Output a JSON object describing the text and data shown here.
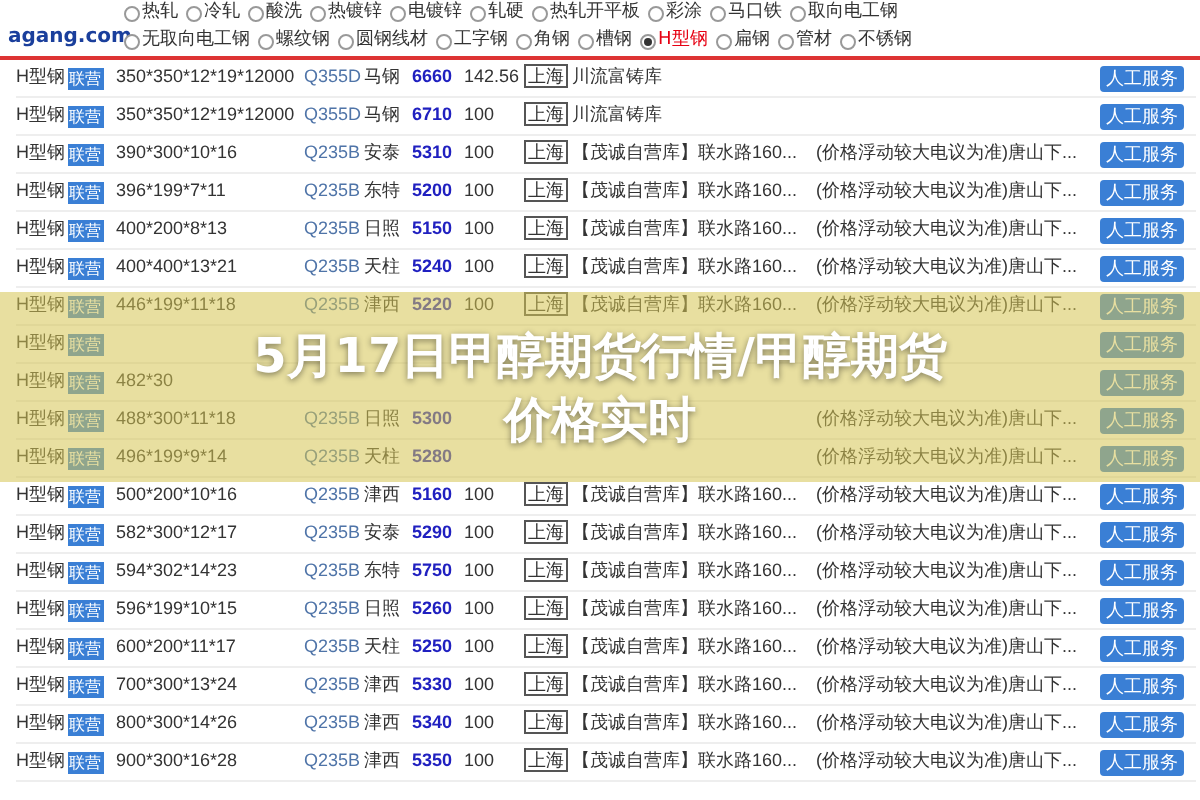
{
  "header": {
    "logo": "agang.com",
    "filters": [
      {
        "label": "热轧",
        "selected": false
      },
      {
        "label": "冷轧",
        "selected": false
      },
      {
        "label": "酸洗",
        "selected": false
      },
      {
        "label": "热镀锌",
        "selected": false
      },
      {
        "label": "电镀锌",
        "selected": false
      },
      {
        "label": "轧硬",
        "selected": false
      },
      {
        "label": "热轧开平板",
        "selected": false
      },
      {
        "label": "彩涂",
        "selected": false
      },
      {
        "label": "马口铁",
        "selected": false
      },
      {
        "label": "取向电工钢",
        "selected": false
      },
      {
        "label": "无取向电工钢",
        "selected": false
      },
      {
        "label": "螺纹钢",
        "selected": false
      },
      {
        "label": "圆钢线材",
        "selected": false
      },
      {
        "label": "工字钢",
        "selected": false
      },
      {
        "label": "角钢",
        "selected": false
      },
      {
        "label": "槽钢",
        "selected": false
      },
      {
        "label": "H型钢",
        "selected": true
      },
      {
        "label": "扁钢",
        "selected": false
      },
      {
        "label": "管材",
        "selected": false
      },
      {
        "label": "不锈钢",
        "selected": false
      }
    ]
  },
  "rows": [
    {
      "name": "H型钢",
      "badge": "联营",
      "spec": "350*350*12*19*12000",
      "material": "Q355D",
      "brand": "马钢",
      "price": "6660",
      "qty": "142.56",
      "city": "上海",
      "warehouse": "川流富铸库",
      "note": "",
      "action": "人工服务"
    },
    {
      "name": "H型钢",
      "badge": "联营",
      "spec": "350*350*12*19*12000",
      "material": "Q355D",
      "brand": "马钢",
      "price": "6710",
      "qty": "100",
      "city": "上海",
      "warehouse": "川流富铸库",
      "note": "",
      "action": "人工服务"
    },
    {
      "name": "H型钢",
      "badge": "联营",
      "spec": "390*300*10*16",
      "material": "Q235B",
      "brand": "安泰",
      "price": "5310",
      "qty": "100",
      "city": "上海",
      "warehouse": "【茂诚自营库】联水路160...",
      "note": "(价格浮动较大电议为准)唐山下...",
      "action": "人工服务"
    },
    {
      "name": "H型钢",
      "badge": "联营",
      "spec": "396*199*7*11",
      "material": "Q235B",
      "brand": "东特",
      "price": "5200",
      "qty": "100",
      "city": "上海",
      "warehouse": "【茂诚自营库】联水路160...",
      "note": "(价格浮动较大电议为准)唐山下...",
      "action": "人工服务"
    },
    {
      "name": "H型钢",
      "badge": "联营",
      "spec": "400*200*8*13",
      "material": "Q235B",
      "brand": "日照",
      "price": "5150",
      "qty": "100",
      "city": "上海",
      "warehouse": "【茂诚自营库】联水路160...",
      "note": "(价格浮动较大电议为准)唐山下...",
      "action": "人工服务"
    },
    {
      "name": "H型钢",
      "badge": "联营",
      "spec": "400*400*13*21",
      "material": "Q235B",
      "brand": "天柱",
      "price": "5240",
      "qty": "100",
      "city": "上海",
      "warehouse": "【茂诚自营库】联水路160...",
      "note": "(价格浮动较大电议为准)唐山下...",
      "action": "人工服务"
    },
    {
      "name": "H型钢",
      "badge": "联营",
      "spec": "446*199*11*18",
      "material": "Q235B",
      "brand": "津西",
      "price": "5220",
      "qty": "100",
      "city": "上海",
      "warehouse": "【茂诚自营库】联水路160...",
      "note": "(价格浮动较大电议为准)唐山下...",
      "action": "人工服务"
    },
    {
      "name": "H型钢",
      "badge": "联营",
      "spec": "",
      "material": "",
      "brand": "",
      "price": "",
      "qty": "",
      "city": "",
      "warehouse": "",
      "note": "",
      "action": "人工服务"
    },
    {
      "name": "H型钢",
      "badge": "联营",
      "spec": "482*30",
      "material": "",
      "brand": "",
      "price": "",
      "qty": "",
      "city": "",
      "warehouse": "",
      "note": "",
      "action": "人工服务"
    },
    {
      "name": "H型钢",
      "badge": "联营",
      "spec": "488*300*11*18",
      "material": "Q235B",
      "brand": "日照",
      "price": "5300",
      "qty": "",
      "city": "",
      "warehouse": "",
      "note": "(价格浮动较大电议为准)唐山下...",
      "action": "人工服务"
    },
    {
      "name": "H型钢",
      "badge": "联营",
      "spec": "496*199*9*14",
      "material": "Q235B",
      "brand": "天柱",
      "price": "5280",
      "qty": "",
      "city": "",
      "warehouse": "",
      "note": "(价格浮动较大电议为准)唐山下...",
      "action": "人工服务"
    },
    {
      "name": "H型钢",
      "badge": "联营",
      "spec": "500*200*10*16",
      "material": "Q235B",
      "brand": "津西",
      "price": "5160",
      "qty": "100",
      "city": "上海",
      "warehouse": "【茂诚自营库】联水路160...",
      "note": "(价格浮动较大电议为准)唐山下...",
      "action": "人工服务"
    },
    {
      "name": "H型钢",
      "badge": "联营",
      "spec": "582*300*12*17",
      "material": "Q235B",
      "brand": "安泰",
      "price": "5290",
      "qty": "100",
      "city": "上海",
      "warehouse": "【茂诚自营库】联水路160...",
      "note": "(价格浮动较大电议为准)唐山下...",
      "action": "人工服务"
    },
    {
      "name": "H型钢",
      "badge": "联营",
      "spec": "594*302*14*23",
      "material": "Q235B",
      "brand": "东特",
      "price": "5750",
      "qty": "100",
      "city": "上海",
      "warehouse": "【茂诚自营库】联水路160...",
      "note": "(价格浮动较大电议为准)唐山下...",
      "action": "人工服务"
    },
    {
      "name": "H型钢",
      "badge": "联营",
      "spec": "596*199*10*15",
      "material": "Q235B",
      "brand": "日照",
      "price": "5260",
      "qty": "100",
      "city": "上海",
      "warehouse": "【茂诚自营库】联水路160...",
      "note": "(价格浮动较大电议为准)唐山下...",
      "action": "人工服务"
    },
    {
      "name": "H型钢",
      "badge": "联营",
      "spec": "600*200*11*17",
      "material": "Q235B",
      "brand": "天柱",
      "price": "5250",
      "qty": "100",
      "city": "上海",
      "warehouse": "【茂诚自营库】联水路160...",
      "note": "(价格浮动较大电议为准)唐山下...",
      "action": "人工服务"
    },
    {
      "name": "H型钢",
      "badge": "联营",
      "spec": "700*300*13*24",
      "material": "Q235B",
      "brand": "津西",
      "price": "5330",
      "qty": "100",
      "city": "上海",
      "warehouse": "【茂诚自营库】联水路160...",
      "note": "(价格浮动较大电议为准)唐山下...",
      "action": "人工服务"
    },
    {
      "name": "H型钢",
      "badge": "联营",
      "spec": "800*300*14*26",
      "material": "Q235B",
      "brand": "津西",
      "price": "5340",
      "qty": "100",
      "city": "上海",
      "warehouse": "【茂诚自营库】联水路160...",
      "note": "(价格浮动较大电议为准)唐山下...",
      "action": "人工服务"
    },
    {
      "name": "H型钢",
      "badge": "联营",
      "spec": "900*300*16*28",
      "material": "Q235B",
      "brand": "津西",
      "price": "5350",
      "qty": "100",
      "city": "上海",
      "warehouse": "【茂诚自营库】联水路160...",
      "note": "(价格浮动较大电议为准)唐山下...",
      "action": "人工服务"
    }
  ],
  "banner": {
    "title_lines": [
      "5月17日甲醇期货行情/甲醇期货",
      "价格实时"
    ]
  }
}
